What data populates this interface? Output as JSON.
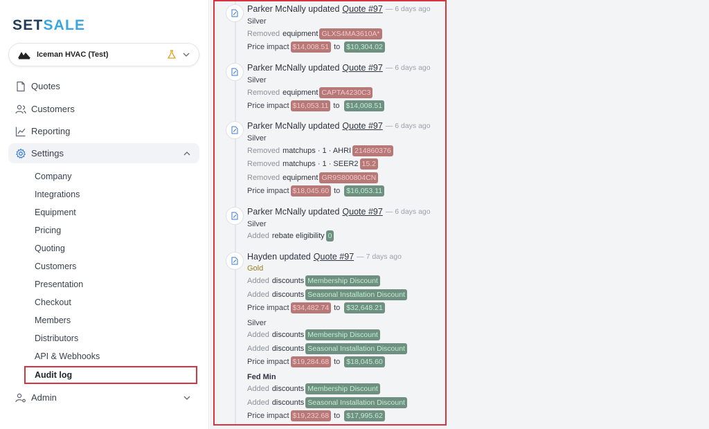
{
  "brand": {
    "part1": "SET",
    "part2": "SALE"
  },
  "org": {
    "name": "Iceman HVAC (Test)"
  },
  "nav": {
    "quotes": "Quotes",
    "customers": "Customers",
    "reporting": "Reporting",
    "settings": "Settings",
    "admin": "Admin"
  },
  "settings_sub": [
    "Company",
    "Integrations",
    "Equipment",
    "Pricing",
    "Quoting",
    "Customers",
    "Presentation",
    "Checkout",
    "Members",
    "Distributors",
    "API & Webhooks",
    "Audit log"
  ],
  "feed": {
    "e1": {
      "user": "Parker McNally",
      "verb": "updated",
      "quote": "Quote #97",
      "ago": "— 6 days ago",
      "tier": "Silver",
      "c1": {
        "action": "Removed",
        "field": "equipment",
        "value": "GLXS4MA3610A*"
      },
      "price": {
        "label": "Price impact",
        "from": "$14,008.51",
        "to_word": "to",
        "to": "$10,304.02"
      }
    },
    "e2": {
      "user": "Parker McNally",
      "verb": "updated",
      "quote": "Quote #97",
      "ago": "— 6 days ago",
      "tier": "Silver",
      "c1": {
        "action": "Removed",
        "field": "equipment",
        "value": "CAPTA4230C3"
      },
      "price": {
        "label": "Price impact",
        "from": "$16,053.11",
        "to_word": "to",
        "to": "$14,008.51"
      }
    },
    "e3": {
      "user": "Parker McNally",
      "verb": "updated",
      "quote": "Quote #97",
      "ago": "— 6 days ago",
      "tier": "Silver",
      "c1": {
        "action": "Removed",
        "field": "matchups · 1 · AHRI",
        "value": "214860376"
      },
      "c2": {
        "action": "Removed",
        "field": "matchups · 1 · SEER2",
        "value": "15.2"
      },
      "c3": {
        "action": "Removed",
        "field": "equipment",
        "value": "GR9S800804CN"
      },
      "price": {
        "label": "Price impact",
        "from": "$18,045.60",
        "to_word": "to",
        "to": "$16,053.11"
      }
    },
    "e4": {
      "user": "Parker McNally",
      "verb": "updated",
      "quote": "Quote #97",
      "ago": "— 6 days ago",
      "tier": "Silver",
      "c1": {
        "action": "Added",
        "field": "rebate eligibility",
        "value": "0"
      }
    },
    "e5": {
      "user": "Hayden",
      "verb": "updated",
      "quote": "Quote #97",
      "ago": "— 7 days ago",
      "gold": {
        "tier": "Gold",
        "c1": {
          "action": "Added",
          "field": "discounts",
          "value": "Membership Discount"
        },
        "c2": {
          "action": "Added",
          "field": "discounts",
          "value": "Seasonal Installation Discount"
        },
        "price": {
          "label": "Price impact",
          "from": "$34,482.74",
          "to_word": "to",
          "to": "$32,648.21"
        }
      },
      "silver": {
        "tier": "Silver",
        "c1": {
          "action": "Added",
          "field": "discounts",
          "value": "Membership Discount"
        },
        "c2": {
          "action": "Added",
          "field": "discounts",
          "value": "Seasonal Installation Discount"
        },
        "price": {
          "label": "Price impact",
          "from": "$19,284.68",
          "to_word": "to",
          "to": "$18,045.60"
        }
      },
      "fedmin": {
        "tier": "Fed Min",
        "c1": {
          "action": "Added",
          "field": "discounts",
          "value": "Membership Discount"
        },
        "c2": {
          "action": "Added",
          "field": "discounts",
          "value": "Seasonal Installation Discount"
        },
        "price": {
          "label": "Price impact",
          "from": "$19,232.68",
          "to_word": "to",
          "to": "$17,995.62"
        }
      }
    }
  },
  "colors": {
    "accent": "#3aa6e0",
    "brand_dark": "#1f3b5b",
    "highlight_red": "#d9333f",
    "pill_red": "#b77878",
    "pill_green": "#6f8f80"
  }
}
